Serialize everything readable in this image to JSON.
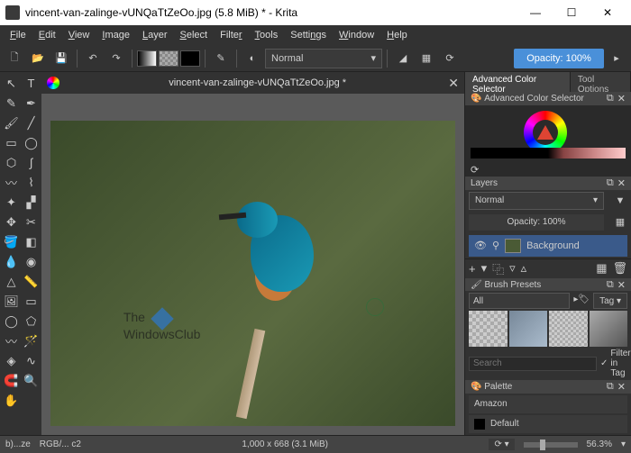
{
  "title": "vincent-van-zalinge-vUNQaTtZeOo.jpg (5.8 MiB) * - Krita",
  "menu": [
    "File",
    "Edit",
    "View",
    "Image",
    "Layer",
    "Select",
    "Filter",
    "Tools",
    "Settings",
    "Window",
    "Help"
  ],
  "toolbar": {
    "mode": "Normal",
    "opacity": "Opacity: 100%"
  },
  "document": {
    "tab_name": "vincent-van-zalinge-vUNQaTtZeOo.jpg *"
  },
  "watermark": {
    "line1": "The",
    "line2": "WindowsClub"
  },
  "dockers": {
    "tabs": [
      "Advanced Color Selector",
      "Tool Options"
    ],
    "color_title": "Advanced Color Selector",
    "layers": {
      "title": "Layers",
      "mode": "Normal",
      "opacity": "Opacity: 100%",
      "items": [
        "Background"
      ]
    },
    "brushes": {
      "title": "Brush Presets",
      "filter": "All",
      "tag": "Tag",
      "search_placeholder": "Search",
      "filter_in_tag": "Filter in Tag"
    },
    "palette": {
      "title": "Palette",
      "items": [
        "Amazon",
        "Default"
      ]
    }
  },
  "status": {
    "fname": "b)...ze",
    "colorspace": "RGB/... c2",
    "dims": "1,000 x 668 (3.1 MiB)",
    "zoom": "56.3%"
  }
}
